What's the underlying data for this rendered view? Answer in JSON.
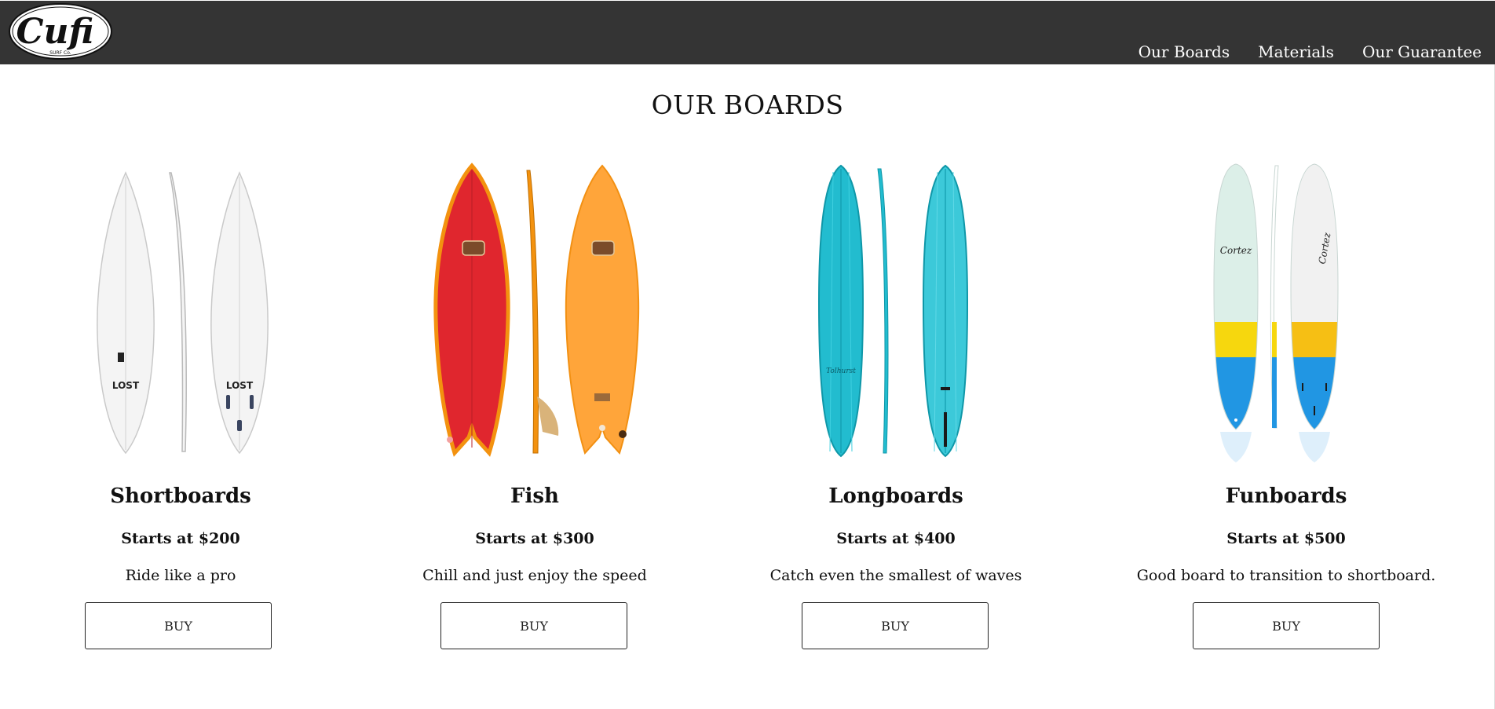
{
  "header": {
    "logo_text": "Cufi",
    "logo_subtext": "SURF Co.",
    "nav": [
      {
        "label": "Our Boards"
      },
      {
        "label": "Materials"
      },
      {
        "label": "Our Guarantee"
      }
    ]
  },
  "main": {
    "title": "OUR BOARDS",
    "cards": [
      {
        "name": "Shortboards",
        "price": "Starts at $200",
        "description": "Ride like a pro",
        "button_label": "BUY"
      },
      {
        "name": "Fish",
        "price": "Starts at $300",
        "description": "Chill and just enjoy the speed",
        "button_label": "BUY"
      },
      {
        "name": "Longboards",
        "price": "Starts at $400",
        "description": "Catch even the smallest of waves",
        "button_label": "BUY"
      },
      {
        "name": "Funboards",
        "price": "Starts at $500",
        "description": "Good board to transition to shortboard.",
        "button_label": "BUY"
      }
    ]
  },
  "colors": {
    "header_bg": "#343434",
    "nav_text": "#ffffff",
    "shortboard": "#f4f4f4",
    "fish_deck": "#e0262e",
    "fish_bottom": "#ffa53a",
    "longboard": "#22bccf",
    "funboard_top": "#dcefe8",
    "funboard_yellow": "#f6d70e",
    "funboard_blue": "#2196e3"
  }
}
